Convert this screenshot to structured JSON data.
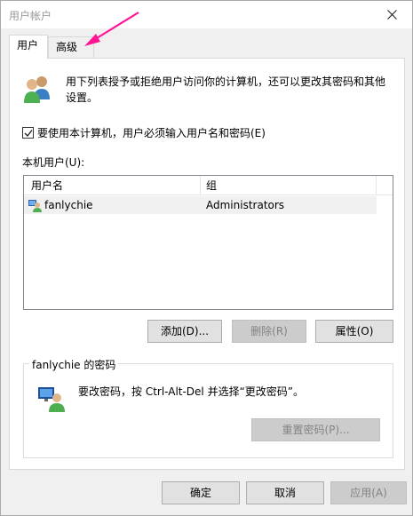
{
  "window": {
    "title": "用户帐户"
  },
  "tabs": [
    {
      "label": "用户",
      "active": true
    },
    {
      "label": "高级",
      "active": false
    }
  ],
  "intro": {
    "text": "用下列表授予或拒绝用户访问你的计算机，还可以更改其密码和其他设置。"
  },
  "require_login": {
    "label": "要使用本计算机，用户必须输入用户名和密码(E)",
    "checked": true
  },
  "users": {
    "label": "本机用户(U):",
    "columns": [
      "用户名",
      "组"
    ],
    "rows": [
      {
        "name": "fanlychie",
        "group": "Administrators"
      }
    ]
  },
  "user_buttons": {
    "add": "添加(D)...",
    "remove": "删除(R)",
    "properties": "属性(O)"
  },
  "password": {
    "group_title": "fanlychie 的密码",
    "text": "要改密码，按 Ctrl-Alt-Del 并选择“更改密码”。",
    "reset_button": "重置密码(P)..."
  },
  "dialog_buttons": {
    "ok": "确定",
    "cancel": "取消",
    "apply": "应用(A)"
  },
  "colors": {
    "annotation_arrow": "#ff1493",
    "list_selection": "#f0f0f0"
  },
  "icons": {
    "close": "close-icon",
    "users": "users-icon",
    "user": "user-icon",
    "password": "password-icon"
  }
}
